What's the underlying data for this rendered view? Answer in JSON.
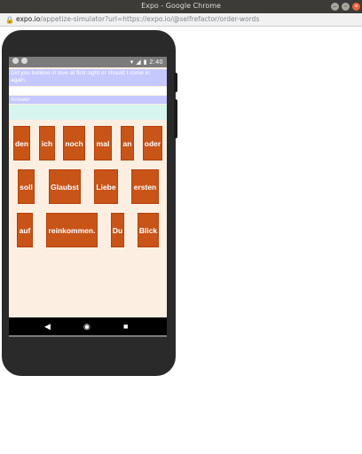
{
  "browser": {
    "title": "Expo - Google Chrome",
    "url_host": "expo.io",
    "url_rest": "/appetize-simulator?url=https://expo.io/@selfrefactor/order-words"
  },
  "device": {
    "status_time": "2:40"
  },
  "app": {
    "sentence": "Did you believe in love at first sight or should I come in again.",
    "answer": "Answer",
    "words": [
      "den",
      "ich",
      "noch",
      "mal",
      "an",
      "oder",
      "soll",
      "Glaubst",
      "Liebe",
      "ersten",
      "auf",
      "reinkommen.",
      "Du",
      "Blick"
    ]
  },
  "colors": {
    "word_tile": "#c85418",
    "screen_bg": "#fcefe2",
    "sentence_bg": "#c5c8ff",
    "teal_strip": "#d8f4ee"
  }
}
